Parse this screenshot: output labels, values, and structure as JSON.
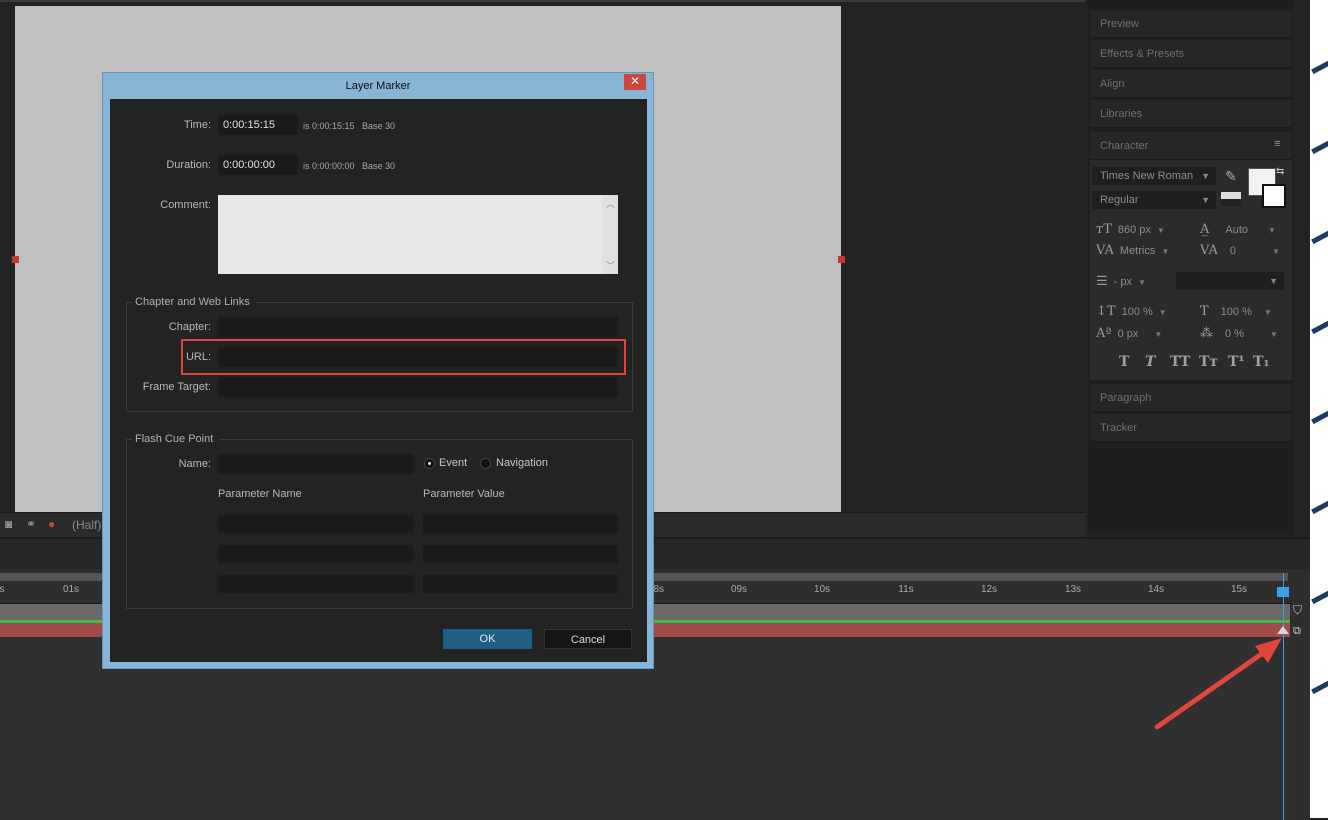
{
  "right_panel": {
    "tabs": [
      "Preview",
      "Effects & Presets",
      "Align",
      "Libraries"
    ],
    "character": {
      "title": "Character",
      "font_family": "Times New Roman",
      "font_style": "Regular",
      "font_size": "860 px",
      "leading": "Auto",
      "kerning": "Metrics",
      "tracking": "0",
      "stroke_width": "- px",
      "vertical_scale": "100 %",
      "horizontal_scale": "100 %",
      "baseline_shift": "0 px",
      "tsume": "0 %",
      "format_buttons": [
        "T",
        "T",
        "TT",
        "Tт",
        "T¹",
        "T₁"
      ]
    },
    "bottom_tabs": [
      "Paragraph",
      "Tracker"
    ]
  },
  "comp": {
    "magnification": "(Half)"
  },
  "timeline": {
    "ticks": [
      "s",
      "01s",
      "08s",
      "09s",
      "10s",
      "11s",
      "12s",
      "13s",
      "14s",
      "15s"
    ]
  },
  "dialog": {
    "title": "Layer Marker",
    "close_label": "✕",
    "time_label": "Time:",
    "time_value": "0:00:15:15",
    "time_info": "is 0:00:15:15",
    "time_base": "Base 30",
    "duration_label": "Duration:",
    "duration_value": "0:00:00:00",
    "duration_info": "is 0:00:00:00",
    "duration_base": "Base 30",
    "comment_label": "Comment:",
    "comment_value": "",
    "chapter_group": {
      "title": "Chapter and Web Links",
      "chapter_label": "Chapter:",
      "chapter_value": "",
      "url_label": "URL:",
      "url_value": "",
      "frame_target_label": "Frame Target:",
      "frame_target_value": ""
    },
    "cue_group": {
      "title": "Flash Cue Point",
      "name_label": "Name:",
      "name_value": "",
      "event_label": "Event",
      "navigation_label": "Navigation",
      "selected": "Event",
      "param_name_header": "Parameter Name",
      "param_value_header": "Parameter Value"
    },
    "ok_label": "OK",
    "cancel_label": "Cancel"
  },
  "colors": {
    "accent_ok": "#1f5f86",
    "highlight": "#e0453e",
    "playhead": "#3ba0e8",
    "layer_bar": "#a34b4b"
  }
}
